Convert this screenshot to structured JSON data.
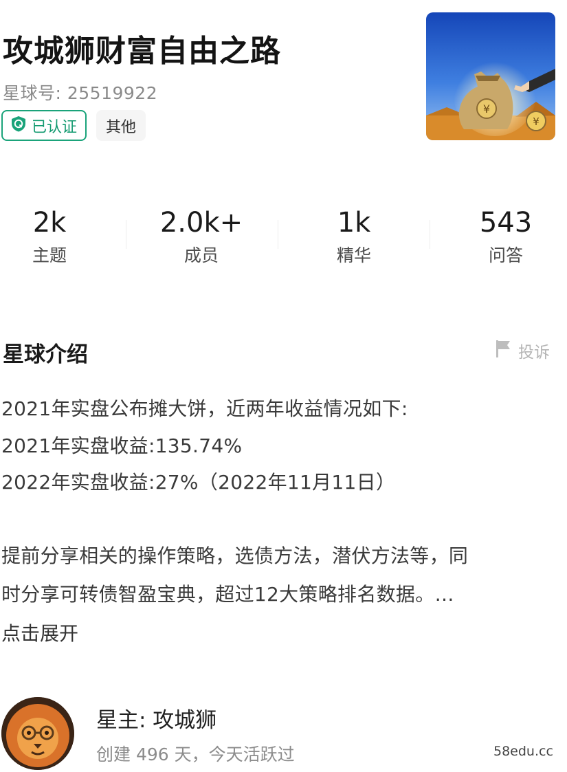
{
  "header": {
    "title": "攻城狮财富自由之路",
    "planet_id": "星球号: 25519922",
    "verified_label": "已认证",
    "category_tag": "其他"
  },
  "stats": [
    {
      "value": "2k",
      "label": "主题"
    },
    {
      "value": "2.0k+",
      "label": "成员"
    },
    {
      "value": "1k",
      "label": "精华"
    },
    {
      "value": "543",
      "label": "问答"
    }
  ],
  "intro": {
    "heading": "星球介绍",
    "report_label": "投诉",
    "lines": [
      "2021年实盘公布摊大饼，近两年收益情况如下:",
      "2021年实盘收益:135.74%",
      "2022年实盘收益:27%（2022年11月11日）",
      "提前分享相关的操作策略，选债方法，潜伏方法等，同",
      "时分享可转债智盈宝典，超过12大策略排名数据。…"
    ],
    "expand_label": "点击展开"
  },
  "owner": {
    "name": "星主: 攻城狮",
    "meta": "创建 496 天，今天活跃过"
  },
  "watermark": "58edu.cc",
  "colors": {
    "verified_green": "#1aa37a",
    "muted_text": "#8a8a8a",
    "report_gray": "#b5b5b5"
  }
}
